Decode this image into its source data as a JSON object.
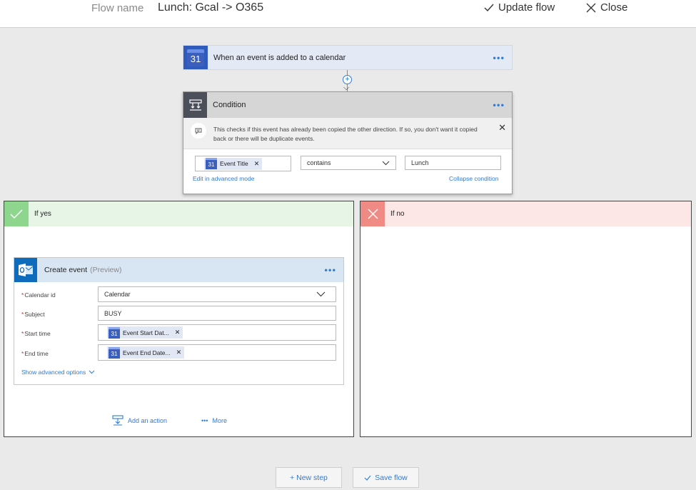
{
  "header": {
    "flow_label": "Flow name",
    "flow_name": "Lunch: Gcal -> O365",
    "update_label": "Update flow",
    "close_label": "Close"
  },
  "trigger": {
    "icon_text": "31",
    "title": "When an event is added to a calendar",
    "menu": "•••"
  },
  "condition": {
    "title": "Condition",
    "menu": "•••",
    "comment": "This checks if this event has already been copied the other direction. If so, you don't want it copied back or there will be duplicate events.",
    "left_token": "Event Title",
    "left_token_icon": "31",
    "operator": "contains",
    "value": "Lunch",
    "edit_advanced": "Edit in advanced mode",
    "collapse": "Collapse condition"
  },
  "if_yes": {
    "label": "If yes",
    "color": "#8ed68e",
    "header_bg": "#e6f5e6"
  },
  "if_no": {
    "label": "If no",
    "color": "#f08a85",
    "header_bg": "#fde6e6"
  },
  "action": {
    "title": "Create event",
    "preview": "(Preview)",
    "menu": "•••",
    "fields": {
      "calendar_id_label": "Calendar id",
      "calendar_id_value": "Calendar",
      "subject_label": "Subject",
      "subject_value": "BUSY",
      "start_label": "Start time",
      "start_token": "Event Start Dat...",
      "end_label": "End time",
      "end_token": "Event End Date...",
      "token_icon": "31"
    },
    "show_advanced": "Show advanced options"
  },
  "branch_actions": {
    "add_action": "Add an action",
    "more_dots": "•••",
    "more": "More"
  },
  "footer": {
    "new_step": "+ New step",
    "save_flow": "Save flow"
  },
  "colors": {
    "accent": "#2f7bd3",
    "trigger_icon": "#2f5bbd",
    "outlook_blue": "#0f6cbd"
  }
}
